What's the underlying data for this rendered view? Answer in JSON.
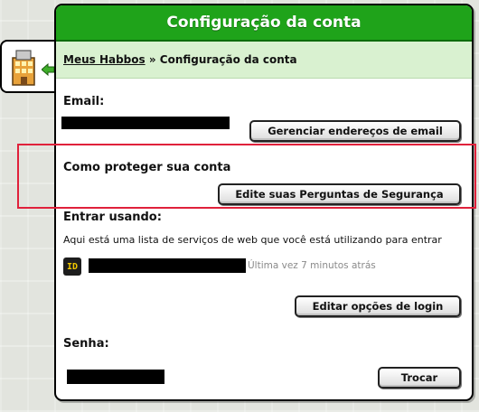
{
  "window": {
    "title": "Configuração da conta"
  },
  "breadcrumb": {
    "link": "Meus Habbos",
    "separator": " » ",
    "current": "Configuração da conta"
  },
  "email": {
    "heading": "Email:",
    "button": "Gerenciar endereços de email"
  },
  "security": {
    "heading": "Como proteger sua conta",
    "button": "Edite suas Perguntas de Segurança"
  },
  "login": {
    "heading": "Entrar usando:",
    "description": "Aqui está uma lista de serviços de web que você está utilizando para entrar",
    "id_badge": "ID",
    "last_seen": "Última vez 7 minutos atrás",
    "button": "Editar opções de login"
  },
  "password": {
    "heading": "Senha:",
    "button": "Trocar"
  },
  "colors": {
    "title_green": "#1fa31a",
    "breadcrumb_bg": "#d9f1d0",
    "highlight": "#e0213b"
  },
  "icons": {
    "side_tab": "habbo-building-icon",
    "arrow": "green-arrow-icon"
  }
}
